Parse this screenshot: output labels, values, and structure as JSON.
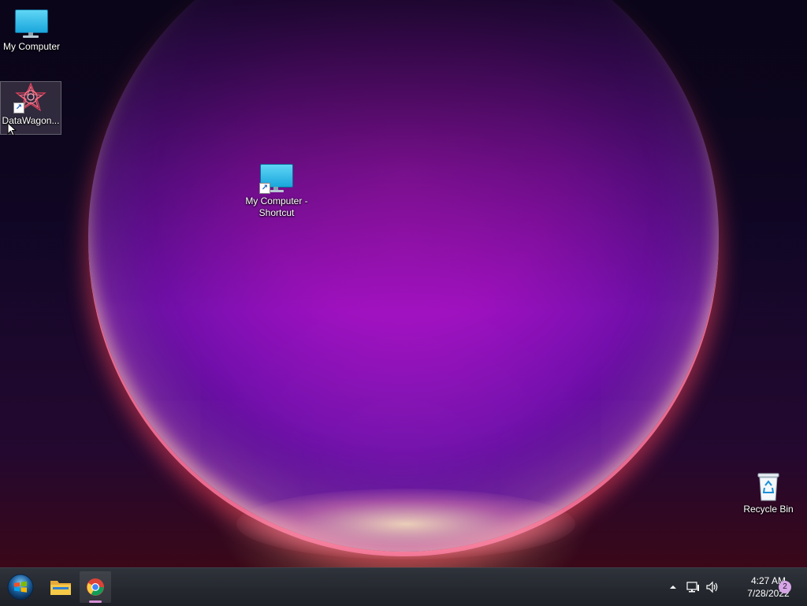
{
  "desktop": {
    "icons": [
      {
        "label": "My Computer"
      },
      {
        "label": "DataWagon..."
      },
      {
        "label": "My Computer - Shortcut"
      },
      {
        "label": "Recycle Bin"
      }
    ]
  },
  "taskbar": {
    "start_icon": "windows-start-orb-icon",
    "pinned": [
      {
        "icon": "file-explorer-folder-icon"
      },
      {
        "icon": "chrome-icon",
        "active": true
      }
    ],
    "tray": {
      "overflow_icon": "chevron-up-icon",
      "network_icon": "network-icon",
      "volume_icon": "volume-icon",
      "time": "4:27 AM",
      "date": "7/28/2022",
      "notification_count": "2"
    }
  },
  "colors": {
    "taskbar_bg": "#1f2229",
    "accent_underline": "#d68fd6",
    "orb_core": "#b014c8"
  }
}
